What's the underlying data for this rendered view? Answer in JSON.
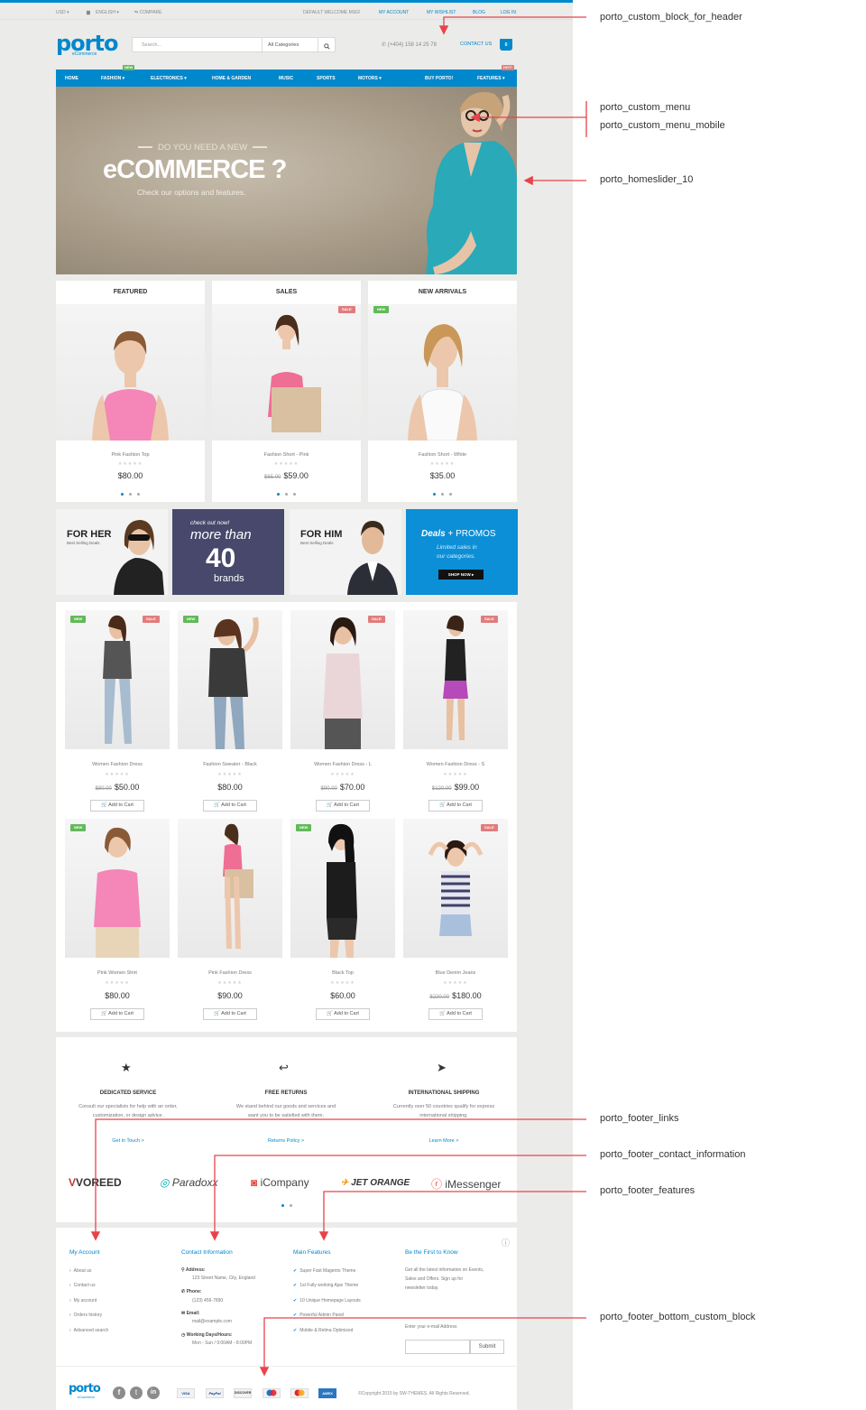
{
  "topbar": {
    "currency": "USD ▾",
    "language": "ENGLISH ▾",
    "compare": "COMPARE",
    "welcome": "DEFAULT WELCOME MSG!",
    "links": [
      "MY ACCOUNT",
      "MY WISHLIST",
      "BLOG",
      "LOG IN"
    ]
  },
  "header": {
    "logo": "porto",
    "logo_sub": "eCommerce",
    "search_placeholder": "Search...",
    "category": "All Categories",
    "phone": "(+404) 158 14 25 78",
    "contact": "CONTACT US",
    "cart_count": "0"
  },
  "nav": {
    "items": [
      "HOME",
      "FASHION ▾",
      "ELECTRONICS ▾",
      "HOME & GARDEN",
      "MUSIC",
      "SPORTS",
      "MOTORS ▾",
      "BUY PORTO!",
      "FEATURES ▾"
    ],
    "tag_new": "NEW",
    "tag_hot": "HOT!"
  },
  "hero": {
    "pre": "DO YOU NEED A NEW",
    "title": "eCOMMERCE ?",
    "subtitle": "Check our options and features."
  },
  "showcase": [
    {
      "title": "FEATURED",
      "name": "Pink Fashion Top",
      "old": "",
      "price": "$80.00",
      "badge": ""
    },
    {
      "title": "SALES",
      "name": "Fashion Short - Pink",
      "old": "$65.00",
      "price": "$59.00",
      "badge": "SALE"
    },
    {
      "title": "NEW ARRIVALS",
      "name": "Fashion Short - White",
      "old": "",
      "price": "$35.00",
      "badge": "NEW"
    }
  ],
  "banners": {
    "her_title": "FOR HER",
    "her_sub": "Best Selling Deals",
    "brands_pre": "check out now!",
    "brands_mid": "more than",
    "brands_num": "40",
    "brands_word": "brands",
    "him_title": "FOR HIM",
    "him_sub": "Best Selling Deals",
    "deals_a": "Deals",
    "deals_b": "+ PROMOS",
    "deals_text_1": "Limited sales in",
    "deals_text_2": "our categories.",
    "deals_btn": "SHOP NOW ▸"
  },
  "products": [
    {
      "name": "Women Fashion Dress",
      "old": "$80.00",
      "price": "$50.00",
      "badges": [
        "NEW",
        "SALE"
      ]
    },
    {
      "name": "Fashion Sweater - Black",
      "old": "",
      "price": "$80.00",
      "badges": [
        "NEW"
      ]
    },
    {
      "name": "Women Fashion Dress - L",
      "old": "$90.00",
      "price": "$70.00",
      "badges": [
        "SALE"
      ]
    },
    {
      "name": "Women Fashion Dress - S",
      "old": "$120.00",
      "price": "$99.00",
      "badges": [
        "SALE"
      ]
    },
    {
      "name": "Pink Women Shirt",
      "old": "",
      "price": "$80.00",
      "badges": [
        "NEW"
      ]
    },
    {
      "name": "Pink Fashion Dress",
      "old": "",
      "price": "$90.00",
      "badges": []
    },
    {
      "name": "Black Top",
      "old": "",
      "price": "$60.00",
      "badges": [
        "NEW"
      ]
    },
    {
      "name": "Blue Denim Jeans",
      "old": "$220.00",
      "price": "$180.00",
      "badges": [
        "SALE"
      ]
    }
  ],
  "add_to_cart": "Add to Cart",
  "features": [
    {
      "title": "DEDICATED SERVICE",
      "text": "Consult our specialists for help with an order, customization, or design advice.",
      "link": "Get in Touch >"
    },
    {
      "title": "FREE RETURNS",
      "text": "We stand behind our goods and services and want you to be satisfied with them.",
      "link": "Returns Policy >"
    },
    {
      "title": "INTERNATIONAL SHIPPING",
      "text": "Currently over 50 countries qualify for express international shipping.",
      "link": "Learn More >"
    }
  ],
  "brands": [
    "VOREED",
    "Paradoxx",
    "iCompany",
    "JET ORANGE",
    "iMessenger"
  ],
  "footer": {
    "account_title": "My Account",
    "account_links": [
      "About us",
      "Contact us",
      "My account",
      "Orders history",
      "Advanced search"
    ],
    "contact_title": "Contact Information",
    "address_label": "Address:",
    "address": "123 Street Name, City, England",
    "phone_label": "Phone:",
    "phone": "(123) 456-7890",
    "email_label": "Email:",
    "email": "mail@example.com",
    "hours_label": "Working Days/Hours:",
    "hours": "Mon - Sun / 9:00AM - 8:00PM",
    "features_title": "Main Features",
    "features_list": [
      "Super Fast Magento Theme",
      "1st Fully working Ajax Theme",
      "10 Unique Homepage Layouts",
      "Powerful Admin Panel",
      "Mobile & Retina Optimized"
    ],
    "news_title": "Be the First to Know",
    "news_text_1": "Get all the latest information on Events,",
    "news_text_2": "Sales and Offers. Sign up for",
    "news_text_3": "newsletter today.",
    "news_label": "Enter your e-mail Address",
    "submit": "Submit",
    "logo": "porto",
    "logo_sub": "eCommerce",
    "payments": [
      "VISA",
      "PayPal",
      "DISCOVER",
      "",
      "",
      "AMEX"
    ],
    "copyright": "©Copyright 2015 by SW-THEMES. All Rights Reserved."
  },
  "annotations": [
    "porto_custom_block_for_header",
    "porto_custom_menu",
    "porto_custom_menu_mobile",
    "porto_homeslider_10",
    "porto_footer_links",
    "porto_footer_contact_information",
    "porto_footer_features",
    "porto_footer_bottom_custom_block"
  ],
  "colors": {
    "accent": "#0088cc",
    "arrow": "#e8434b",
    "sale": "#e27c7c",
    "new": "#62b959",
    "navy": "#47486b"
  }
}
